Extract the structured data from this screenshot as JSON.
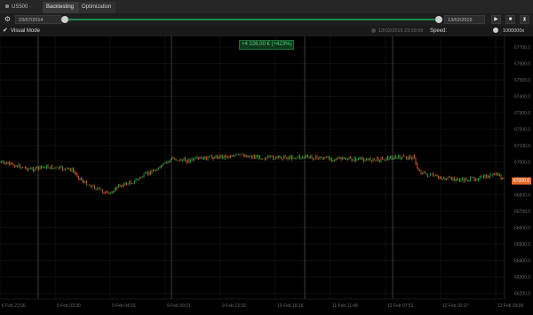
{
  "tabs": {
    "symbol": "US500 · m5",
    "backtesting": "Backtesting",
    "optimization": "Optimization"
  },
  "controls": {
    "start_date": "23/07/2014",
    "end_date": "13/02/2015",
    "gear_icon": "gear-icon",
    "play_icon": "play-icon",
    "stop_icon": "stop-icon",
    "hourglass_icon": "hourglass-icon"
  },
  "visual": {
    "checkbox": "✔",
    "label": "Visual Mode",
    "sim_time": "13/02/2015 23:59:59",
    "speed_label": "Speed:",
    "speed_value": "1000000x"
  },
  "chart": {
    "pnl_badge": "+4 226.00 € (+423%)",
    "current_price": "67000.0",
    "y_ticks": [
      "67700.0",
      "67600.0",
      "67500.0",
      "67400.0",
      "67300.0",
      "67200.0",
      "67100.0",
      "67000.0",
      "66900.0",
      "66800.0",
      "66700.0",
      "66600.0",
      "66500.0",
      "66400.0",
      "66300.0",
      "66200.0"
    ],
    "x_ticks": [
      "6 Feb 22:00",
      "9 Feb 03:30",
      "9 Feb 04:15",
      "9 Feb 09:21",
      "9 Feb 13:33",
      "10 Feb 15:18",
      "11 Feb 11:48",
      "12 Feb 07:51",
      "12 Feb 02:27",
      "13 Feb 03:00"
    ],
    "colors": {
      "up": "#2fa84f",
      "down": "#e36a2c",
      "grid": "#1c1c1c",
      "session": "#4a4a4a"
    }
  }
}
